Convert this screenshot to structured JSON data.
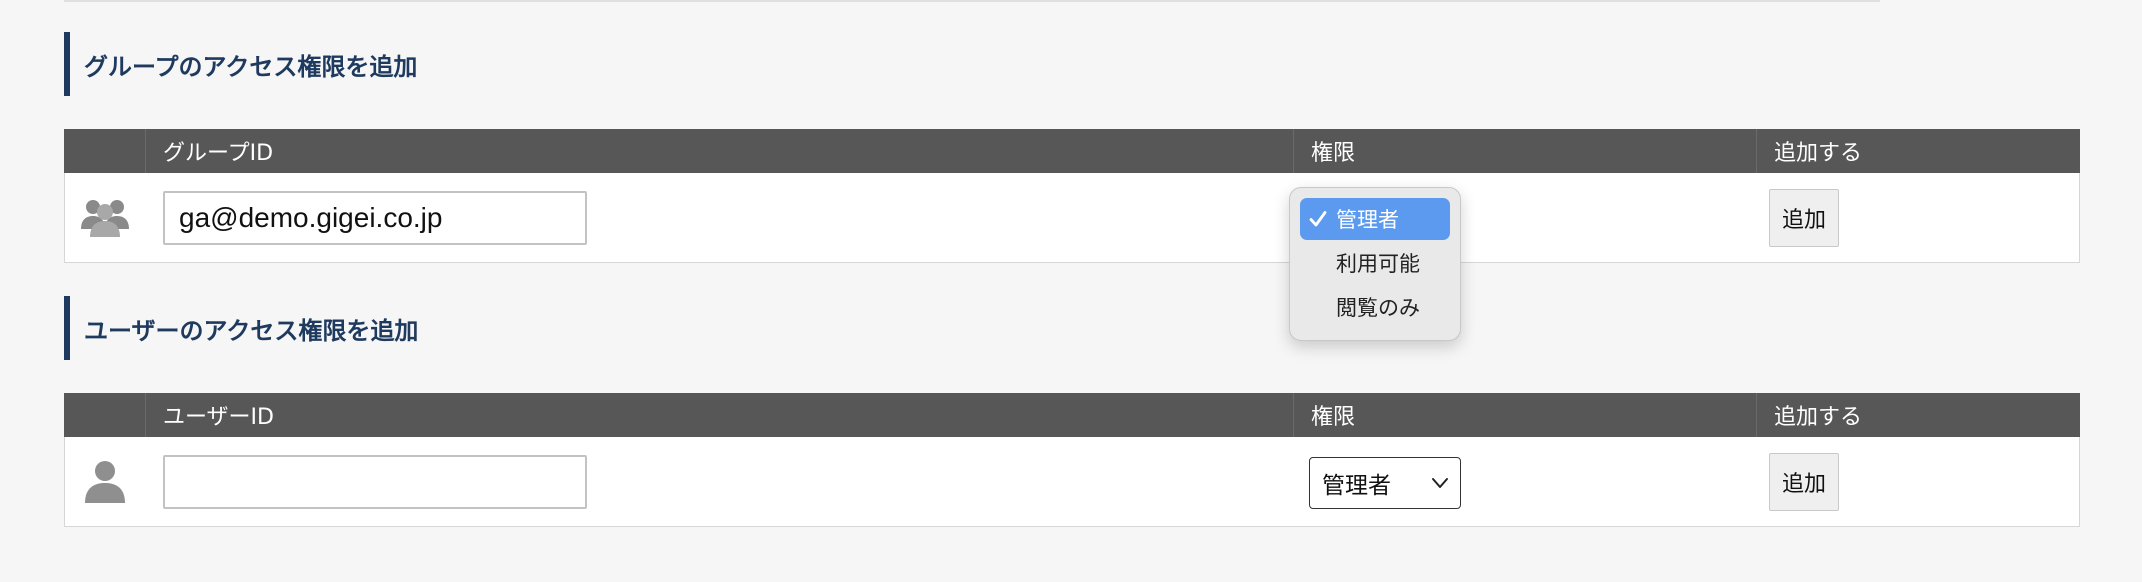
{
  "group_section": {
    "title": "グループのアクセス権限を追加",
    "table": {
      "headers": [
        "",
        "グループID",
        "権限",
        "追加する"
      ],
      "row": {
        "icon": "group-icon",
        "id_value": "ga@demo.gigei.co.jp",
        "add_label": "追加"
      }
    },
    "permission_dropdown": {
      "state": "open",
      "options": [
        "管理者",
        "利用可能",
        "閲覧のみ"
      ],
      "selected": "管理者",
      "selected_color": "#5c9af0"
    }
  },
  "user_section": {
    "title": "ユーザーのアクセス権限を追加",
    "table": {
      "headers": [
        "",
        "ユーザーID",
        "権限",
        "追加する"
      ],
      "row": {
        "icon": "user-icon",
        "id_value": "",
        "permission_value": "管理者",
        "add_label": "追加"
      }
    }
  },
  "colors": {
    "accent": "#1f3a5f",
    "header_bg": "#575757",
    "page_bg": "#f6f6f6"
  }
}
